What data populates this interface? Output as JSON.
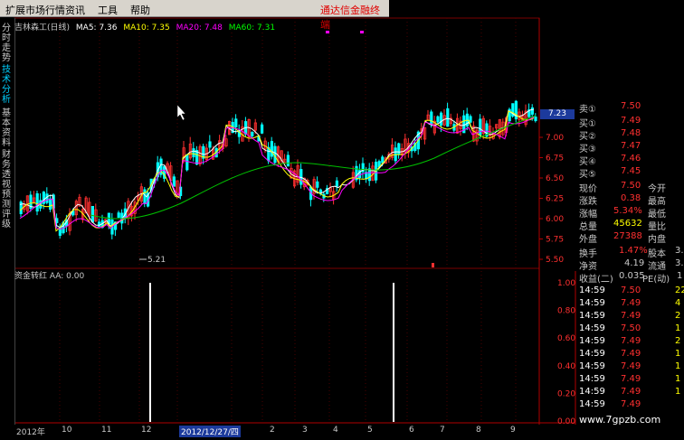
{
  "menu": {
    "items": [
      "扩展市场行情",
      "资讯",
      "工具",
      "帮助"
    ],
    "brand": "通达信金融终端"
  },
  "sidebar": {
    "tabs": [
      "分时走势",
      "技术分析",
      "基本资料",
      "财务透视",
      "预测评级"
    ],
    "active": 1
  },
  "main_legend": {
    "name": "吉林森工(日线)",
    "ma5": "MA5: 7.36",
    "ma10": "MA10: 7.35",
    "ma20": "MA20: 7.48",
    "ma60": "MA60: 7.31",
    "colors": {
      "name": "#c8c8c8",
      "ma5": "#ffffff",
      "ma10": "#ffff00",
      "ma20": "#ff00ff",
      "ma60": "#00ff00"
    }
  },
  "sub_legend": "资金转红 AA: 0.00",
  "low_marker": "5.21",
  "current_price_box": "7.23",
  "price_axis": [
    "7.00",
    "6.75",
    "6.50",
    "6.25",
    "6.00",
    "5.75",
    "5.50"
  ],
  "sub_axis": [
    "1.00",
    "0.80",
    "0.60",
    "0.40",
    "0.20",
    "0.00"
  ],
  "dates": {
    "labels": [
      "2012年",
      "10",
      "11",
      "12",
      "2012/12/27/四",
      "2",
      "3",
      "4",
      "5",
      "6",
      "7",
      "8",
      "9"
    ]
  },
  "quote": {
    "asks": [
      {
        "label": "卖①",
        "price": "7.50"
      },
      {
        "label": "买①",
        "price": "7.49"
      },
      {
        "label": "买②",
        "price": "7.48"
      },
      {
        "label": "买③",
        "price": "7.47"
      },
      {
        "label": "买④",
        "price": "7.46"
      },
      {
        "label": "买⑤",
        "price": "7.45"
      }
    ],
    "stats": [
      {
        "label": "现价",
        "value": "7.50",
        "label2": "今开"
      },
      {
        "label": "涨跌",
        "value": "0.38",
        "label2": "最高"
      },
      {
        "label": "涨幅",
        "value": "5.34%",
        "label2": "最低"
      },
      {
        "label": "总量",
        "value": "45632",
        "label2": "量比"
      },
      {
        "label": "外盘",
        "value": "27388",
        "label2": "内盘"
      }
    ],
    "stats2": [
      {
        "label": "换手",
        "value": "1.47%",
        "label2": "股本",
        "value2": "3."
      },
      {
        "label": "净资",
        "value": "4.19",
        "label2": "流通",
        "value2": "3."
      },
      {
        "label": "收益(二)",
        "value": "0.035",
        "label2": "PE(动)",
        "value2": "1"
      }
    ],
    "ticks": [
      {
        "time": "14:59",
        "price": "7.50",
        "vol": "22"
      },
      {
        "time": "14:59",
        "price": "7.49",
        "vol": "4"
      },
      {
        "time": "14:59",
        "price": "7.49",
        "vol": "2"
      },
      {
        "time": "14:59",
        "price": "7.50",
        "vol": "1"
      },
      {
        "time": "14:59",
        "price": "7.49",
        "vol": "2"
      },
      {
        "time": "14:59",
        "price": "7.49",
        "vol": "1"
      },
      {
        "time": "14:59",
        "price": "7.49",
        "vol": "1"
      },
      {
        "time": "14:59",
        "price": "7.49",
        "vol": "1"
      },
      {
        "time": "14:59",
        "price": "7.49",
        "vol": "1"
      },
      {
        "time": "14:59",
        "price": "7.49",
        "vol": ""
      }
    ]
  },
  "watermark": "www.7gpzb.com"
}
